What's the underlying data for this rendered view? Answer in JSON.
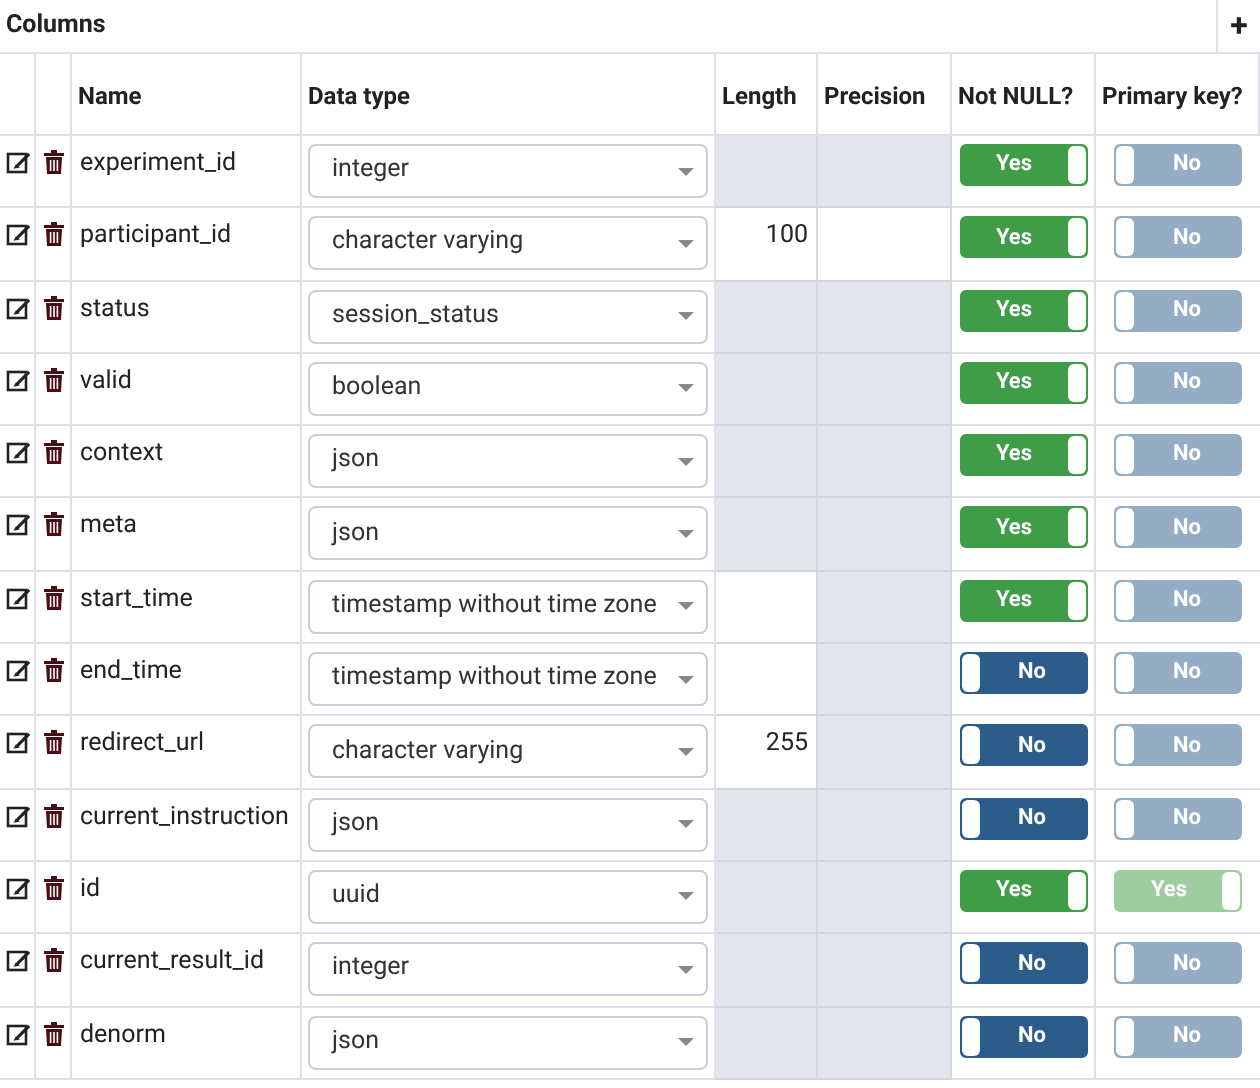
{
  "panel": {
    "title": "Columns",
    "add_button": "+"
  },
  "columns": [
    "Name",
    "Data type",
    "Length",
    "Precision",
    "Not NULL?",
    "Primary key?"
  ],
  "rows": [
    {
      "name": "experiment_id",
      "data_type": "integer",
      "length_editable": false,
      "precision_editable": false,
      "not_null": {
        "on": true,
        "label": "Yes"
      },
      "primary_key": {
        "on": false,
        "label": "No",
        "disabled": true
      }
    },
    {
      "name": "participant_id",
      "data_type": "character varying",
      "length": "100",
      "length_editable": true,
      "precision_editable": true,
      "not_null": {
        "on": true,
        "label": "Yes"
      },
      "primary_key": {
        "on": false,
        "label": "No",
        "disabled": true
      }
    },
    {
      "name": "status",
      "data_type": "session_status",
      "length_editable": false,
      "precision_editable": false,
      "not_null": {
        "on": true,
        "label": "Yes"
      },
      "primary_key": {
        "on": false,
        "label": "No",
        "disabled": true
      }
    },
    {
      "name": "valid",
      "data_type": "boolean",
      "length_editable": false,
      "precision_editable": false,
      "not_null": {
        "on": true,
        "label": "Yes"
      },
      "primary_key": {
        "on": false,
        "label": "No",
        "disabled": true
      }
    },
    {
      "name": "context",
      "data_type": "json",
      "length_editable": false,
      "precision_editable": false,
      "not_null": {
        "on": true,
        "label": "Yes"
      },
      "primary_key": {
        "on": false,
        "label": "No",
        "disabled": true
      }
    },
    {
      "name": "meta",
      "data_type": "json",
      "length_editable": false,
      "precision_editable": false,
      "not_null": {
        "on": true,
        "label": "Yes"
      },
      "primary_key": {
        "on": false,
        "label": "No",
        "disabled": true
      }
    },
    {
      "name": "start_time",
      "data_type": "timestamp without time zone",
      "length_editable": true,
      "precision_editable": false,
      "not_null": {
        "on": true,
        "label": "Yes"
      },
      "primary_key": {
        "on": false,
        "label": "No",
        "disabled": true
      }
    },
    {
      "name": "end_time",
      "data_type": "timestamp without time zone",
      "length_editable": true,
      "precision_editable": false,
      "not_null": {
        "on": false,
        "label": "No"
      },
      "primary_key": {
        "on": false,
        "label": "No",
        "disabled": true
      }
    },
    {
      "name": "redirect_url",
      "data_type": "character varying",
      "length": "255",
      "length_editable": true,
      "precision_editable": false,
      "not_null": {
        "on": false,
        "label": "No"
      },
      "primary_key": {
        "on": false,
        "label": "No",
        "disabled": true
      }
    },
    {
      "name": "current_instruction",
      "data_type": "json",
      "length_editable": false,
      "precision_editable": false,
      "not_null": {
        "on": false,
        "label": "No"
      },
      "primary_key": {
        "on": false,
        "label": "No",
        "disabled": true
      }
    },
    {
      "name": "id",
      "data_type": "uuid",
      "length_editable": false,
      "precision_editable": false,
      "not_null": {
        "on": true,
        "label": "Yes"
      },
      "primary_key": {
        "on": true,
        "label": "Yes",
        "disabled": true
      }
    },
    {
      "name": "current_result_id",
      "data_type": "integer",
      "length_editable": false,
      "precision_editable": false,
      "not_null": {
        "on": false,
        "label": "No"
      },
      "primary_key": {
        "on": false,
        "label": "No",
        "disabled": true
      }
    },
    {
      "name": "denorm",
      "data_type": "json",
      "length_editable": false,
      "precision_editable": false,
      "not_null": {
        "on": false,
        "label": "No"
      },
      "primary_key": {
        "on": false,
        "label": "No",
        "disabled": true
      }
    }
  ]
}
